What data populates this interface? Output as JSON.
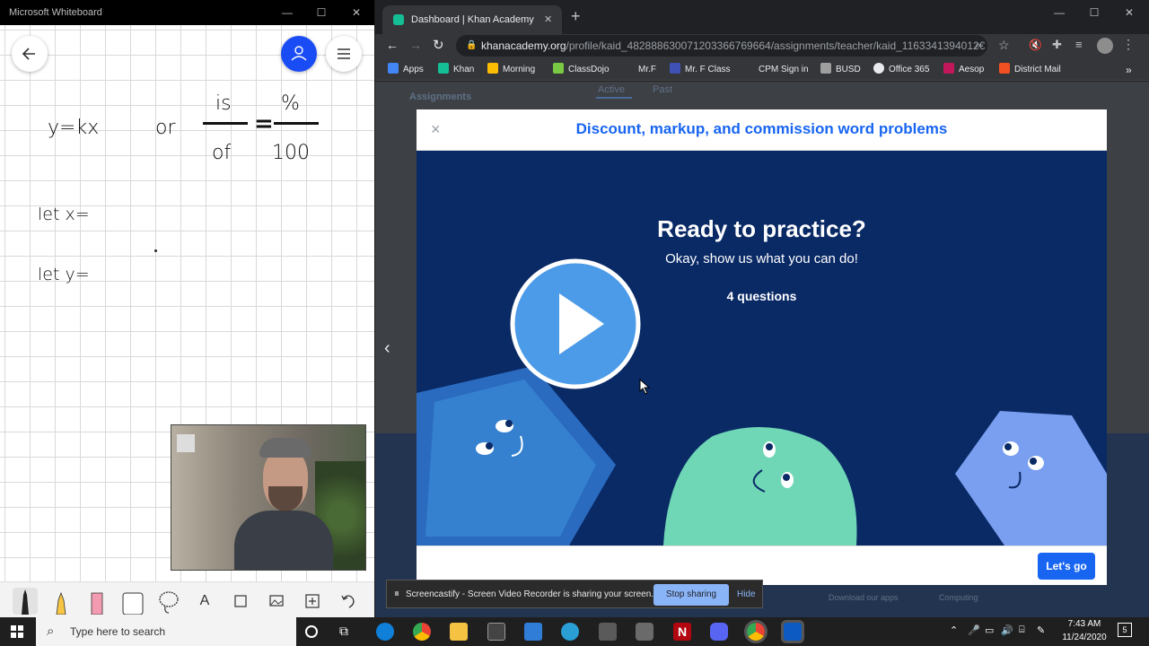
{
  "whiteboard": {
    "window_title": "Microsoft Whiteboard",
    "math": {
      "eq1": "y=kx",
      "or": "or",
      "num_left": "is",
      "den_left": "of",
      "equals": "=",
      "num_right": "%",
      "den_right": "100",
      "let_x": "let x=",
      "let_y": "let y="
    }
  },
  "browser": {
    "tab_title": "Dashboard | Khan Academy",
    "url_host": "khanacademy.org",
    "url_path": "/profile/kaid_482888630071203366769664/assignments/teacher/kaid_1163341394012€",
    "bookmarks": [
      {
        "label": "Apps",
        "color": "#4285f4"
      },
      {
        "label": "Khan",
        "color": "#14bf96"
      },
      {
        "label": "Morning",
        "color": "#fbbc04"
      },
      {
        "label": "ClassDojo",
        "color": "#7ac943"
      },
      {
        "label": "Mr.F",
        "color": "#35363a"
      },
      {
        "label": "Mr. F Class",
        "color": "#3f51b5"
      },
      {
        "label": "CPM Sign in",
        "color": "#35363a"
      },
      {
        "label": "BUSD",
        "color": "#9e9e9e"
      },
      {
        "label": "Office 365",
        "color": "#e8eaed"
      },
      {
        "label": "Aesop",
        "color": "#c2185b"
      },
      {
        "label": "District Mail",
        "color": "#f25022"
      }
    ],
    "background_tabs": {
      "assignments": "Assignments",
      "active": "Active",
      "past": "Past"
    },
    "bottom_links": {
      "computing": "Computing",
      "download": "Download our apps"
    }
  },
  "modal": {
    "title": "Discount, markup, and commission word problems",
    "heading": "Ready to practice?",
    "subheading": "Okay, show us what you can do!",
    "questions": "4 questions",
    "button": "Let's go",
    "close": "×",
    "colors": {
      "accent": "#1865f2",
      "body_bg": "#0a2a66"
    }
  },
  "sharebar": {
    "message": "Screencastify - Screen Video Recorder is sharing your screen.",
    "stop": "Stop sharing",
    "hide": "Hide"
  },
  "taskbar": {
    "search_placeholder": "Type here to search",
    "time": "7:43 AM",
    "date": "11/24/2020",
    "notification_count": "5"
  }
}
